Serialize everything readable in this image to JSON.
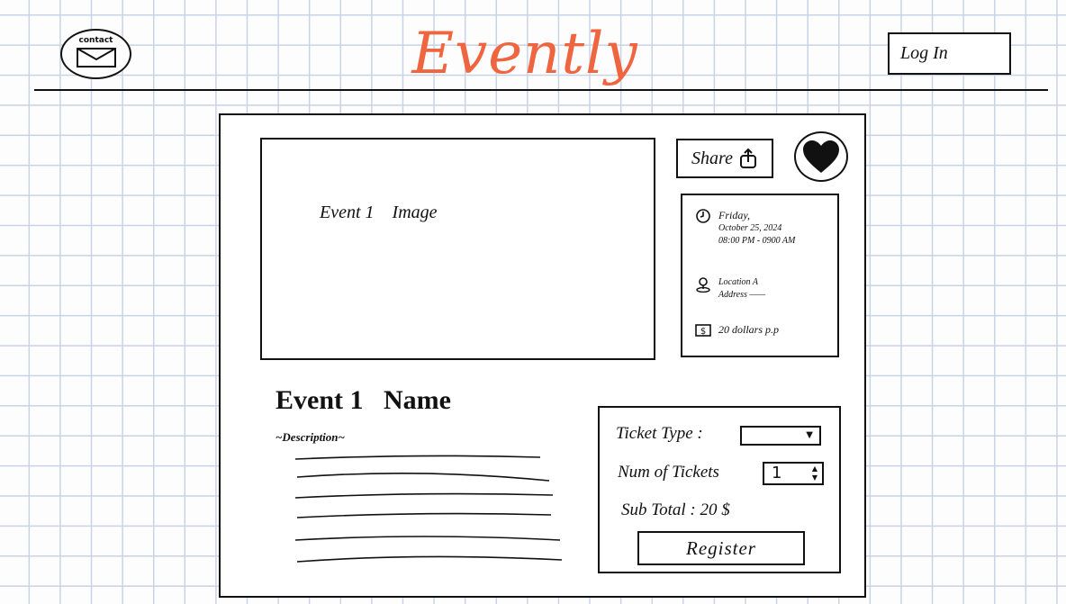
{
  "header": {
    "contact_label": "contact",
    "logo": "Evently",
    "logo_color": "#ef6540",
    "login_label": "Log In"
  },
  "event": {
    "image_label": "Event 1    Image",
    "share_label": "Share",
    "name": "Event 1   Name",
    "description_label": "~Description~",
    "description_line_count": 6
  },
  "info": {
    "date_day": "Friday,",
    "date": "October 25, 2024",
    "time": "08:00 PM - 0900 AM",
    "location_name": "Location A",
    "address": "Address ——",
    "price": "20 dollars p.p"
  },
  "purchase": {
    "ticket_type_label": "Ticket Type :",
    "ticket_type_value": "",
    "num_tickets_label": "Num of Tickets",
    "num_tickets_value": "1",
    "subtotal_label": "Sub Total  :  20 $",
    "register_label": "Register"
  },
  "icons": {
    "contact": "mail-icon",
    "share": "share-icon",
    "favorite": "heart-icon",
    "date": "clock-icon",
    "location": "location-pin-icon",
    "price": "dollar-icon"
  }
}
